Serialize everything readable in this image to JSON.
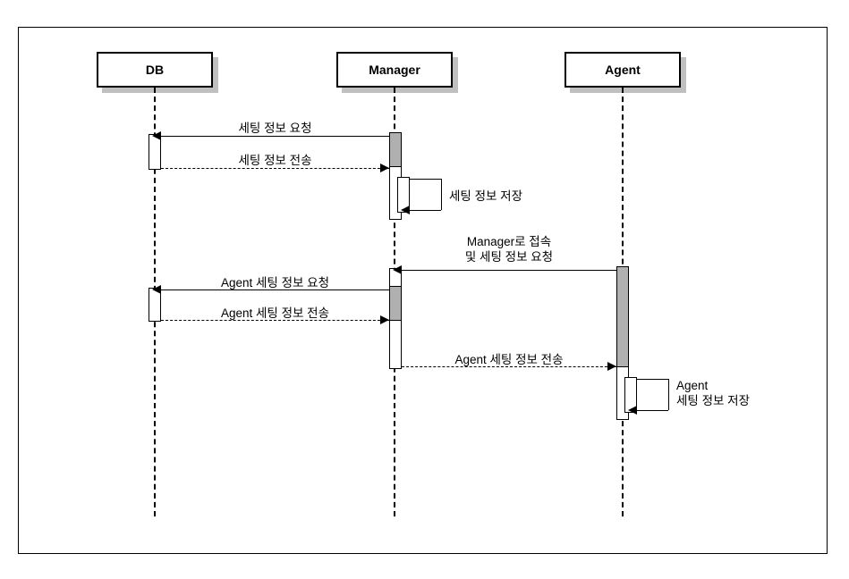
{
  "lifelines": {
    "db": {
      "label": "DB"
    },
    "manager": {
      "label": "Manager"
    },
    "agent": {
      "label": "Agent"
    }
  },
  "messages": {
    "m1": "세팅 정보 요청",
    "m2": "세팅 정보 전송",
    "m3": "세팅 정보 저장",
    "m4_line1": "Manager로 접속",
    "m4_line2": "및 세팅 정보 요청",
    "m5": "Agent 세팅 정보 요청",
    "m6": "Agent 세팅 정보 전송",
    "m7": "Agent 세팅 정보 전송",
    "m8_line1": "Agent",
    "m8_line2": "세팅 정보 저장"
  }
}
